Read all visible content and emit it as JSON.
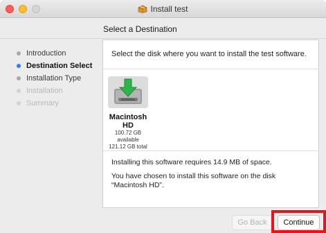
{
  "window": {
    "title": "Install test",
    "title_icon": "package-icon"
  },
  "header": {
    "subtitle": "Select a Destination"
  },
  "steps": [
    {
      "label": "Introduction",
      "state": "done"
    },
    {
      "label": "Destination Select",
      "state": "active"
    },
    {
      "label": "Installation Type",
      "state": "pending"
    },
    {
      "label": "Installation",
      "state": "disabled"
    },
    {
      "label": "Summary",
      "state": "disabled"
    }
  ],
  "main": {
    "prompt": "Select the disk where you want to install the test software.",
    "disk": {
      "name": "Macintosh HD",
      "available": "100.72 GB available",
      "total": "121.12 GB total",
      "icon": "hard-drive-install-icon"
    },
    "requirement": "Installing this software requires 14.9 MB of space.",
    "chosen": "You have chosen to install this software on the disk “Macintosh HD”."
  },
  "buttons": {
    "back": "Go Back",
    "continue": "Continue"
  },
  "colors": {
    "active_step_dot": "#2f7cf6",
    "highlight": "#e8141b",
    "close": "#fc5f57",
    "minimize": "#fdbc2e"
  }
}
